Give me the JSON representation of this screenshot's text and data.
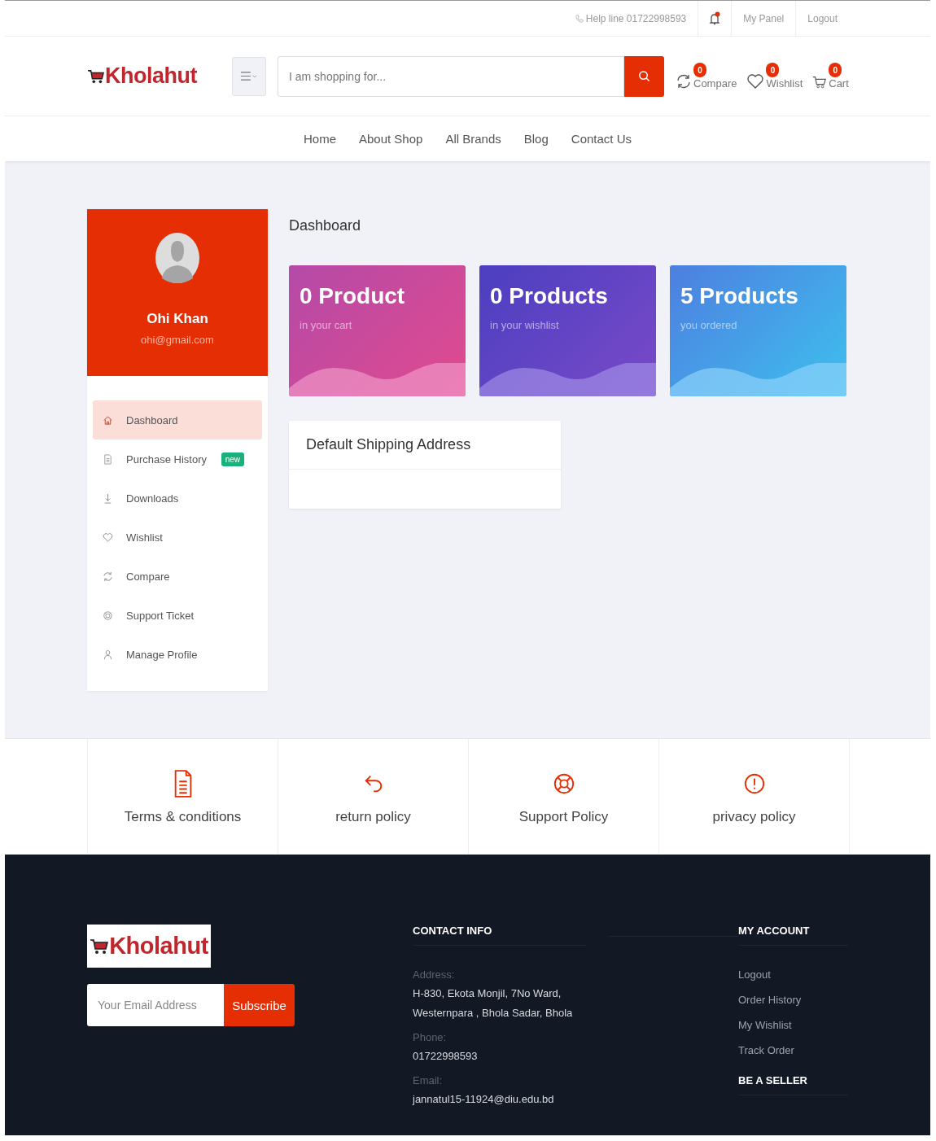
{
  "top_bar": {
    "helpline": "Help line 01722998593",
    "notification_dot": true,
    "links": [
      "My Panel",
      "Logout"
    ]
  },
  "header": {
    "logo": "Kholahut",
    "search": {
      "placeholder": "I am shopping for..."
    },
    "counters": [
      {
        "kind": "compare",
        "count": "0",
        "label": "Compare"
      },
      {
        "kind": "wishlist",
        "count": "0",
        "label": "Wishlist"
      },
      {
        "kind": "cart",
        "count": "0",
        "label": "Cart"
      }
    ]
  },
  "nav": [
    "Home",
    "About Shop",
    "All Brands",
    "Blog",
    "Contact Us"
  ],
  "profile": {
    "name": "Ohi Khan",
    "email": "ohi@gmail.com"
  },
  "sidebar": {
    "items": [
      {
        "kind": "home",
        "label": "Dashboard",
        "selected": true
      },
      {
        "kind": "file",
        "label": "Purchase History",
        "selected": false,
        "badge": "new"
      },
      {
        "kind": "download",
        "label": "Downloads",
        "selected": false
      },
      {
        "kind": "heart",
        "label": "Wishlist",
        "selected": false
      },
      {
        "kind": "refresh",
        "label": "Compare",
        "selected": false
      },
      {
        "kind": "support",
        "label": "Support Ticket",
        "selected": false
      },
      {
        "kind": "user",
        "label": "Manage Profile",
        "selected": false
      }
    ]
  },
  "page_title": "Dashboard",
  "stat_cards": [
    {
      "kind": "pink",
      "value": "0 Product",
      "caption": "in your cart"
    },
    {
      "kind": "purple",
      "value": "0 Products",
      "caption": "in your wishlist"
    },
    {
      "kind": "blue",
      "value": "5 Products",
      "caption": "you ordered"
    }
  ],
  "shipping_card": {
    "title": "Default Shipping Address"
  },
  "policies": [
    {
      "kind": "document",
      "label": "Terms & conditions"
    },
    {
      "kind": "return",
      "label": "return policy"
    },
    {
      "kind": "lifebuoy",
      "label": "Support Policy"
    },
    {
      "kind": "alert",
      "label": "privacy policy"
    }
  ],
  "footer": {
    "logo": "Kholahut",
    "newsletter": {
      "placeholder": "Your Email Address",
      "button": "Subscribe"
    },
    "contact": {
      "heading": "CONTACT INFO",
      "fields": [
        {
          "label": "Address:",
          "lines": [
            "H-830, Ekota Monjil, 7No Ward,",
            "Westernpara , Bhola Sadar, Bhola"
          ]
        },
        {
          "label": "Phone:",
          "lines": [
            "01722998593"
          ]
        },
        {
          "label": "Email:",
          "lines": [
            "jannatul15-11924@diu.edu.bd"
          ]
        }
      ]
    },
    "account": {
      "heading": "MY ACCOUNT",
      "links": [
        "Logout",
        "Order History",
        "My Wishlist",
        "Track Order"
      ]
    },
    "seller_heading": "BE A SELLER"
  }
}
